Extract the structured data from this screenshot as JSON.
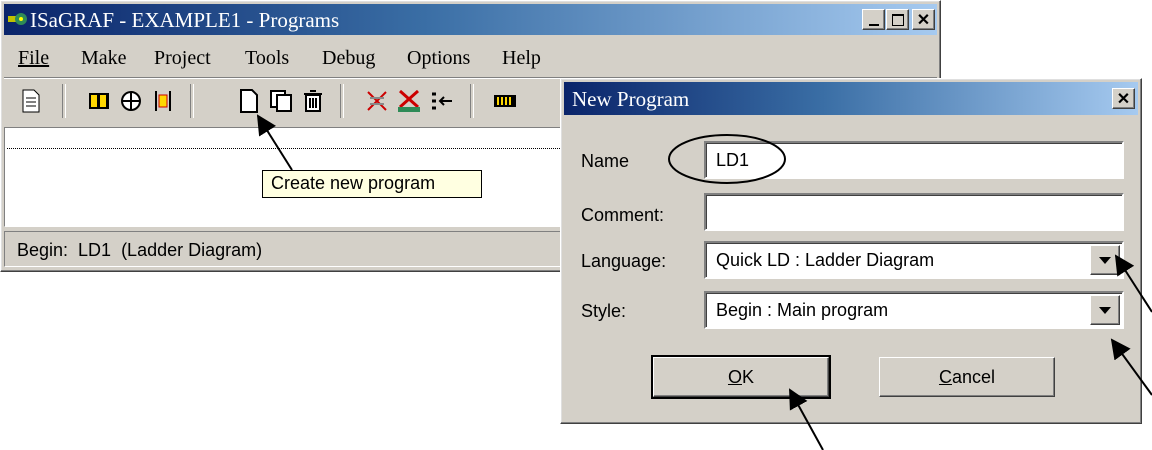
{
  "main_window": {
    "title": "ISaGRAF - EXAMPLE1 - Programs",
    "caption_buttons": [
      "minimize-icon",
      "maximize-icon",
      "close-icon"
    ],
    "menu": [
      {
        "label": "File"
      },
      {
        "label": "Make"
      },
      {
        "label": "Project"
      },
      {
        "label": "Tools"
      },
      {
        "label": "Debug"
      },
      {
        "label": "Options"
      },
      {
        "label": "Help"
      }
    ],
    "toolbar_icons": [
      "edit-program-icon",
      "dictionary-icon",
      "io-connection-icon",
      "definitions-icon",
      "new-program-icon",
      "copy-program-icon",
      "delete-program-icon",
      "verify-icon",
      "make-icon",
      "simulate-icon",
      "link-icon"
    ],
    "tooltip": "Create new program",
    "status": "Begin:  LD1  (Ladder Diagram)"
  },
  "dialog": {
    "title": "New Program",
    "close_icon": "close-icon",
    "fields": {
      "name": {
        "label": "Name",
        "value": "LD1"
      },
      "comment": {
        "label": "Comment:",
        "value": ""
      },
      "language": {
        "label": "Language:",
        "value": "Quick LD : Ladder Diagram"
      },
      "style": {
        "label": "Style:",
        "value": "Begin : Main program"
      }
    },
    "ok_label": "OK",
    "cancel_label": "Cancel"
  },
  "colors": {
    "title_active": "#0a246a",
    "face": "#d4d0c8",
    "tooltip_bg": "#ffffe1"
  }
}
